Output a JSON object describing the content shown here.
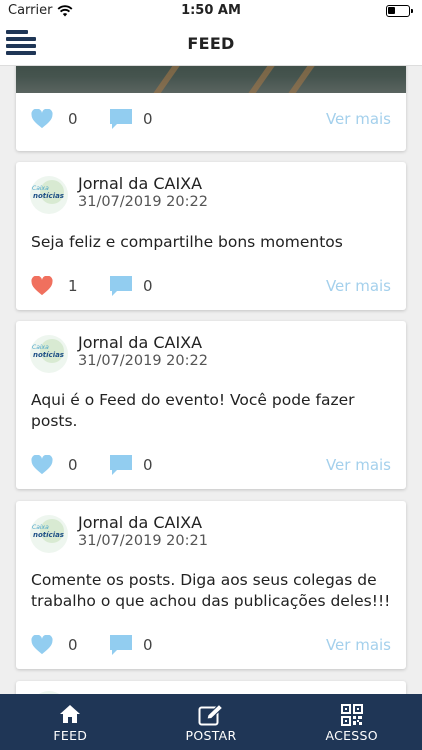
{
  "status_bar": {
    "carrier": "Carrier",
    "time": "1:50 AM",
    "battery_level": 0.35
  },
  "nav": {
    "title": "FEED",
    "menu_icon": "hamburger-menu-icon"
  },
  "top_card": {
    "likes": "0",
    "comments": "0",
    "more_label": "Ver mais"
  },
  "posts": [
    {
      "author": "Jornal da CAIXA",
      "date": "31/07/2019 20:22",
      "text": "Seja feliz e compartilhe bons momentos",
      "likes": "1",
      "liked": true,
      "comments": "0",
      "more_label": "Ver mais"
    },
    {
      "author": "Jornal da CAIXA",
      "date": "31/07/2019 20:22",
      "text": "Aqui é o Feed do evento! Você pode fazer posts.",
      "likes": "0",
      "liked": false,
      "comments": "0",
      "more_label": "Ver mais"
    },
    {
      "author": "Jornal da CAIXA",
      "date": "31/07/2019 20:21",
      "text": "Comente os posts. Diga aos seus colegas de trabalho o que achou das publicações deles!!!",
      "likes": "0",
      "liked": false,
      "comments": "0",
      "more_label": "Ver mais"
    }
  ],
  "avatar_logo": {
    "line1": "Caixa",
    "line2": "notícias"
  },
  "tabs": [
    {
      "label": "FEED",
      "icon": "home-icon"
    },
    {
      "label": "POSTAR",
      "icon": "edit-icon"
    },
    {
      "label": "ACESSO",
      "icon": "qr-code-icon"
    }
  ],
  "colors": {
    "accent": "#1f3656",
    "like_active": "#f0705e",
    "icon_blue": "#92cdf0",
    "link": "#a4d0ec"
  }
}
